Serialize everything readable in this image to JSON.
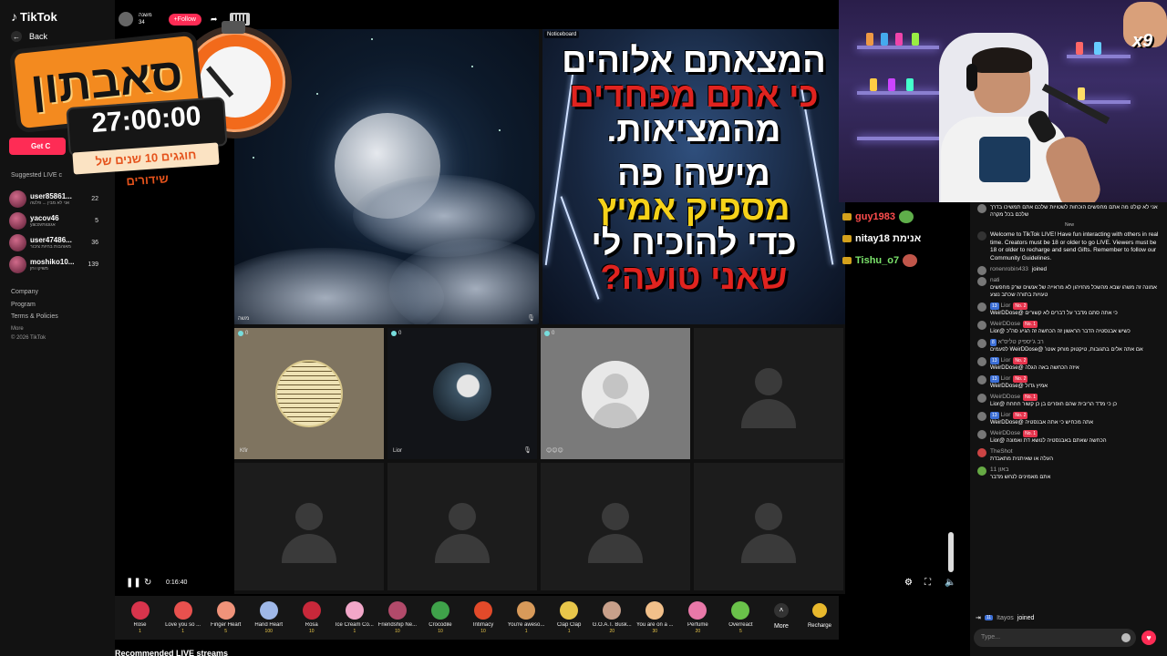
{
  "app": {
    "logo": "TikTok",
    "back": "Back"
  },
  "sidebar": {
    "get_btn": "Get C",
    "suggested_title": "Suggested LIVE c",
    "suggested": [
      {
        "name": "user85861...",
        "sub": "אני לא מבין ... פלטה",
        "count": "22"
      },
      {
        "name": "yacov46",
        "sub": "yacovאגוטות",
        "count": "5"
      },
      {
        "name": "user47486...",
        "sub": "מאוהבות בחיות ציבור",
        "count": "36"
      },
      {
        "name": "moshiko10...",
        "sub": "משיקו וחן",
        "count": "139"
      }
    ],
    "links": [
      "Company",
      "Program",
      "Terms & Policies"
    ],
    "more": "More",
    "copyright": "© 2026 TikTok"
  },
  "banner": {
    "title": "סאבתון",
    "time": "27:00:00",
    "subtitle": "חוגגים 10 שנים של שידורים"
  },
  "live": {
    "host_name": "משנה",
    "host_sub": "34",
    "follow": "+Follow",
    "big_left_label": "משה",
    "notice_tag": "Noticeboard",
    "poster_lines": [
      {
        "text": "המצאתם אלוהים",
        "cls": ""
      },
      {
        "text": "כי אתם מפחדים",
        "cls": "red"
      },
      {
        "text": "מהמציאות.",
        "cls": ""
      },
      {
        "text": "מישהו פה",
        "cls": ""
      },
      {
        "text": "מספיק אמיץ",
        "cls": "yel"
      },
      {
        "text": "כדי להוכיח לי",
        "cls": ""
      },
      {
        "text": "שאני טועה?",
        "cls": "red2"
      }
    ],
    "tiles": {
      "kfir": "Kfir",
      "lior": "Lior",
      "viewers": "0"
    },
    "time": "0:16:40"
  },
  "gifts": [
    {
      "name": "Rose",
      "price": "1",
      "color": "#d8344c"
    },
    {
      "name": "Love you so ...",
      "price": "1",
      "color": "#e8514e"
    },
    {
      "name": "Finger Heart",
      "price": "5",
      "color": "#f0937a"
    },
    {
      "name": "Hand Heart",
      "price": "100",
      "color": "#9fb8e8"
    },
    {
      "name": "Rosa",
      "price": "10",
      "color": "#c8283a"
    },
    {
      "name": "Ice Cream Co...",
      "price": "1",
      "color": "#f2a7c9"
    },
    {
      "name": "Friendship Ne...",
      "price": "10",
      "color": "#b24a6a"
    },
    {
      "name": "Crocodile",
      "price": "10",
      "color": "#3fa24a"
    },
    {
      "name": "Intimacy",
      "price": "10",
      "color": "#e24a2a"
    },
    {
      "name": "You're aweso...",
      "price": "1",
      "color": "#d89a5a"
    },
    {
      "name": "Clap Clap",
      "price": "1",
      "color": "#e8c64a"
    },
    {
      "name": "G.O.A.T. Busk...",
      "price": "20",
      "color": "#c8a08a"
    },
    {
      "name": "You are on a ...",
      "price": "30",
      "color": "#f2c08a"
    },
    {
      "name": "Perfume",
      "price": "20",
      "color": "#e878a8"
    },
    {
      "name": "Overreact",
      "price": "5",
      "color": "#6ac24a"
    }
  ],
  "gift_more": "More",
  "recharge": "Recharge",
  "recommended": "Recommended LIVE streams",
  "overlay_comments": [
    {
      "name": "guy1983",
      "color": "#ff4d4d"
    },
    {
      "name": "nitay18 אנימת",
      "color": "#ffffff"
    },
    {
      "name": "Tishu_o7",
      "color": "#7be36b"
    }
  ],
  "chat": {
    "top_msg": "אני לא קולט מה אתם מחפשים הוכחות לשטויות שלכם אתם תמשיכו בדרך שלכם בכל מקרה",
    "new": "New",
    "welcome": "Welcome to TikTok LIVE! Have fun interacting with others in real time. Creators must be 18 or older to go LIVE. Viewers must be 18 or older to recharge and send Gifts. Remember to follow our Community Guidelines.",
    "joined1_user": "ronenrobin433",
    "joined_word": "joined",
    "messages": [
      {
        "user": "nati",
        "lvl": "",
        "rank": "",
        "body": "אמונה זה משהו שבא מהשכל מהזיהון לא מראייה של אנשים שרק מחפשים טעויות בתורה שכתב נוצע"
      },
      {
        "user": "Lior",
        "lvl": "13",
        "rank": "No. 2",
        "body": "כי אתה סתם מדבר על דברים לא קשורים @WeirDDose"
      },
      {
        "user": "WeirDDose",
        "lvl": "",
        "rank": "No. 1",
        "body": "כשיש אבנסטיה הדבר הראשון זה הכחשה זה הגיע סה\"כ @Lior"
      },
      {
        "user": "רב ג'יספיק טליס\"א",
        "lvl": "8",
        "rank": "",
        "body": "אם אתה אלים בתגובות, טיקטוק מוחק אוטו' @WeirDDose לפעמים"
      },
      {
        "user": "Lior",
        "lvl": "13",
        "rank": "No. 2",
        "body": "איזה הכחשה באה הגלה @WeirDDose"
      },
      {
        "user": "Lior",
        "lvl": "13",
        "rank": "No. 2",
        "body": "אמיץ גדול @WeirDDose"
      },
      {
        "user": "WeirDDose",
        "lvl": "",
        "rank": "No. 1",
        "body": "כן כי מדד הריבית שהם חופרים בן כן קשור חחחח @Lior"
      },
      {
        "user": "Lior",
        "lvl": "13",
        "rank": "No. 2",
        "body": "אתה מכחיש כי אתה אבנסטיה @WeirDDose"
      },
      {
        "user": "WeirDDose",
        "lvl": "",
        "rank": "No. 1",
        "body": "הכחשה שאתם באבנסטיה לנושא דת ואמונה @Lior"
      },
      {
        "user": "TheShot",
        "lvl": "",
        "rank": "",
        "body": "העלה או שאיתנית מתאבדת"
      },
      {
        "user": "באון 11",
        "lvl": "",
        "rank": "",
        "body": "אתם מאמינים לנחש מדבר"
      }
    ],
    "bottom_join_user": "Itayos",
    "bottom_join_lvl": "11",
    "input_placeholder": "Type..."
  }
}
